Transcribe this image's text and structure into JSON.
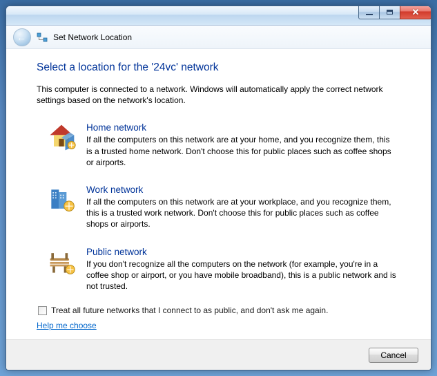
{
  "titlebar": {
    "window_title": "Set Network Location"
  },
  "heading": "Select a location for the '24vc' network",
  "intro": "This computer is connected to a network. Windows will automatically apply the correct network settings based on the network's location.",
  "options": {
    "home": {
      "title": "Home network",
      "desc": "If all the computers on this network are at your home, and you recognize them, this is a trusted home network.  Don't choose this for public places such as coffee shops or airports."
    },
    "work": {
      "title": "Work network",
      "desc": "If all the computers on this network are at your workplace, and you recognize them, this is a trusted work network.  Don't choose this for public places such as coffee shops or airports."
    },
    "public": {
      "title": "Public network",
      "desc": "If you don't recognize all the computers on the network (for example, you're in a coffee shop or airport, or you have mobile broadband), this is a public network and is not trusted."
    }
  },
  "checkbox_label": "Treat all future networks that I connect to as public, and don't ask me again.",
  "help_link": "Help me choose",
  "buttons": {
    "cancel": "Cancel"
  }
}
